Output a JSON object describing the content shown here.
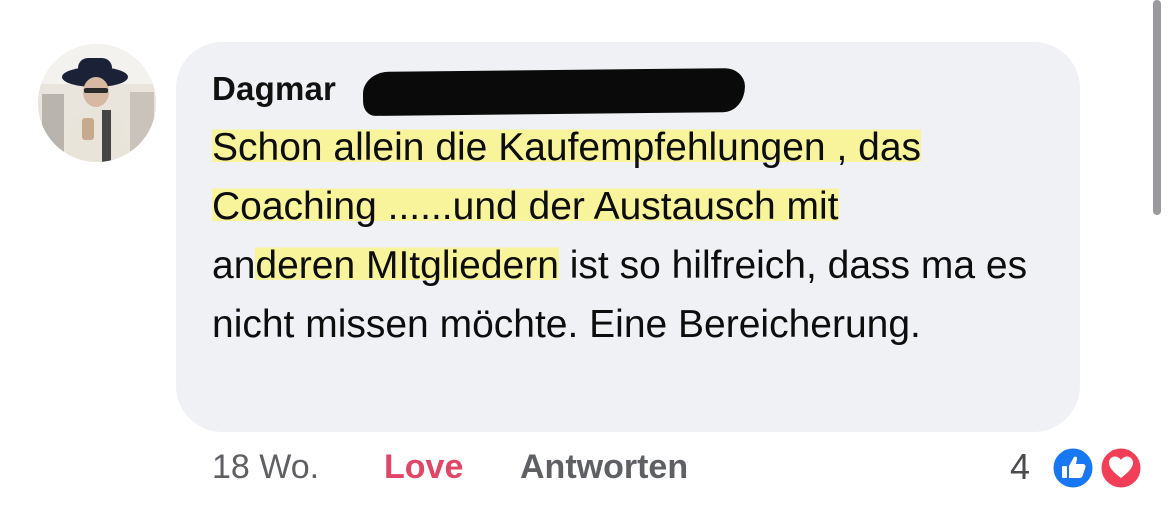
{
  "comment": {
    "author_visible": "Dagmar",
    "text_highlighted_1": "Schon allein die Kaufempfehlungen , das",
    "text_highlighted_2": "Coaching ......und der Austausch mit",
    "text_line3_plain_a": "an",
    "text_highlighted_3": "deren MItgliedern",
    "text_rest": " ist so hilfreich, dass ma es nicht missen möchte. Eine Bereicherung."
  },
  "actions": {
    "time": "18 Wo.",
    "love_label": "Love",
    "reply_label": "Antworten"
  },
  "reactions": {
    "count": "4",
    "types": [
      "like-icon",
      "love-icon"
    ]
  },
  "colors": {
    "bubble": "#f0f1f4",
    "love": "#e24667",
    "like": "#1877f2",
    "highlight": "#f8f48c"
  }
}
